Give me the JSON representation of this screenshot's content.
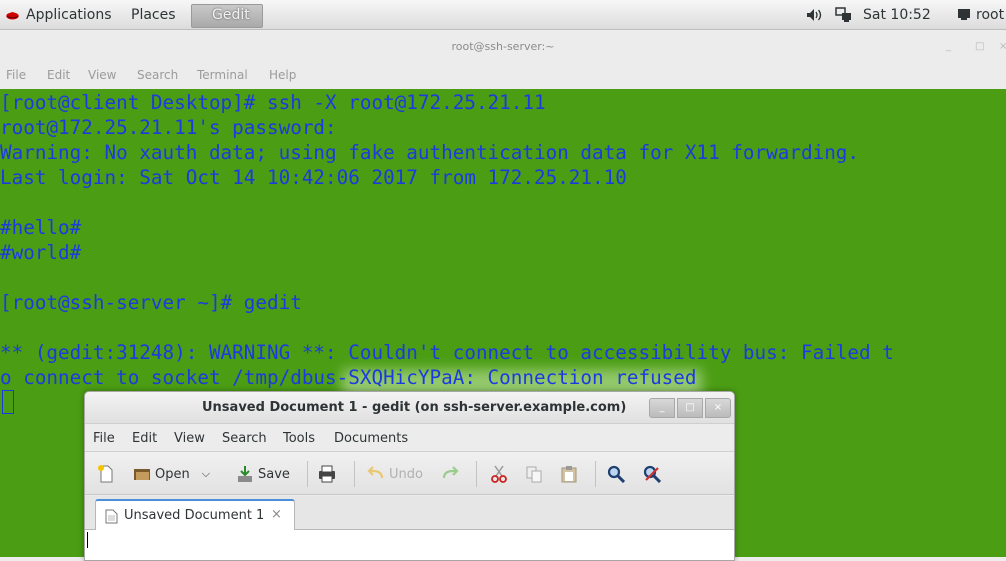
{
  "topbar": {
    "applications": "Applications",
    "places": "Places",
    "active_app": "Gedit",
    "clock": "Sat 10:52",
    "user": "root",
    "icons": [
      "redhat-logo-icon",
      "volume-icon",
      "network-icon",
      "user-icon"
    ]
  },
  "terminal": {
    "window_title": "root@ssh-server:~",
    "menu": [
      "File",
      "Edit",
      "View",
      "Search",
      "Terminal",
      "Help"
    ],
    "background": "#4b9d14",
    "text_color": "#1b3be0",
    "lines": [
      "[root@client Desktop]# ssh -X root@172.25.21.11",
      "root@172.25.21.11's password:",
      "Warning: No xauth data; using fake authentication data for X11 forwarding.",
      "Last login: Sat Oct 14 10:42:06 2017 from 172.25.21.10",
      "",
      "#hello#",
      "#world#",
      "",
      "[root@ssh-server ~]# gedit",
      "",
      "** (gedit:31248): WARNING **: Couldn't connect to accessibility bus: Failed t",
      "o connect to socket /tmp/dbus-SXQHicYPaA: Connection refused"
    ]
  },
  "gedit": {
    "title": "Unsaved Document 1 - gedit (on ssh-server.example.com)",
    "menu": [
      "File",
      "Edit",
      "View",
      "Search",
      "Tools",
      "Documents"
    ],
    "toolbar": {
      "open": "Open",
      "save": "Save",
      "undo": "Undo"
    },
    "tab_label": "Unsaved Document 1",
    "tab_close": "×",
    "window_buttons": [
      "_",
      "□",
      "×"
    ]
  }
}
